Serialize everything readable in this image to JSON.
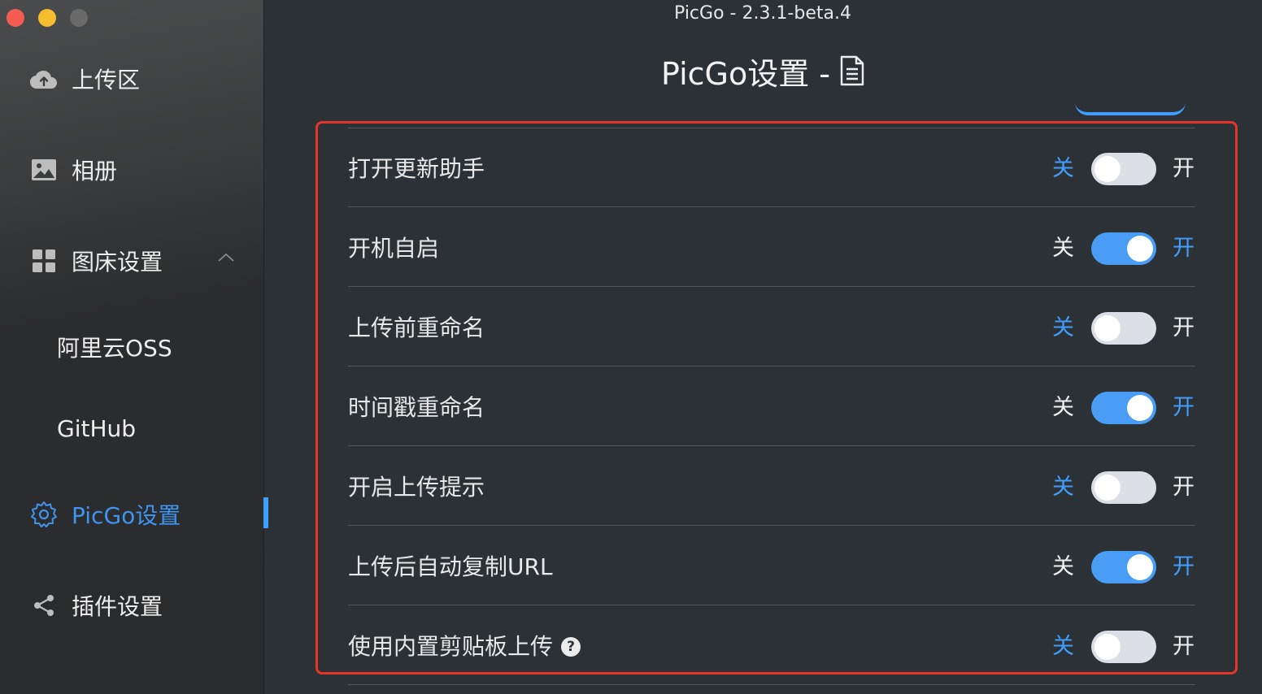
{
  "window": {
    "title": "PicGo - 2.3.1-beta.4"
  },
  "page": {
    "heading": "PicGo设置 -"
  },
  "sidebar": {
    "items": [
      {
        "label": "上传区",
        "icon": "cloud-upload-icon"
      },
      {
        "label": "相册",
        "icon": "picture-icon"
      },
      {
        "label": "图床设置",
        "icon": "grid-icon",
        "expanded": true
      },
      {
        "label": "阿里云OSS"
      },
      {
        "label": "GitHub"
      },
      {
        "label": "PicGo设置",
        "icon": "gear-icon",
        "active": true
      },
      {
        "label": "插件设置",
        "icon": "share-icon"
      }
    ]
  },
  "settings": {
    "off_label": "关",
    "on_label": "开",
    "rows": [
      {
        "label": "打开更新助手",
        "enabled": false
      },
      {
        "label": "开机自启",
        "enabled": true
      },
      {
        "label": "上传前重命名",
        "enabled": false
      },
      {
        "label": "时间戳重命名",
        "enabled": true
      },
      {
        "label": "开启上传提示",
        "enabled": false
      },
      {
        "label": "上传后自动复制URL",
        "enabled": true
      },
      {
        "label": "使用内置剪贴板上传",
        "enabled": false,
        "help": "?"
      }
    ]
  },
  "colors": {
    "accent": "#409eff",
    "highlight_border": "#e5352a",
    "switch_off": "#dcdfe6"
  }
}
